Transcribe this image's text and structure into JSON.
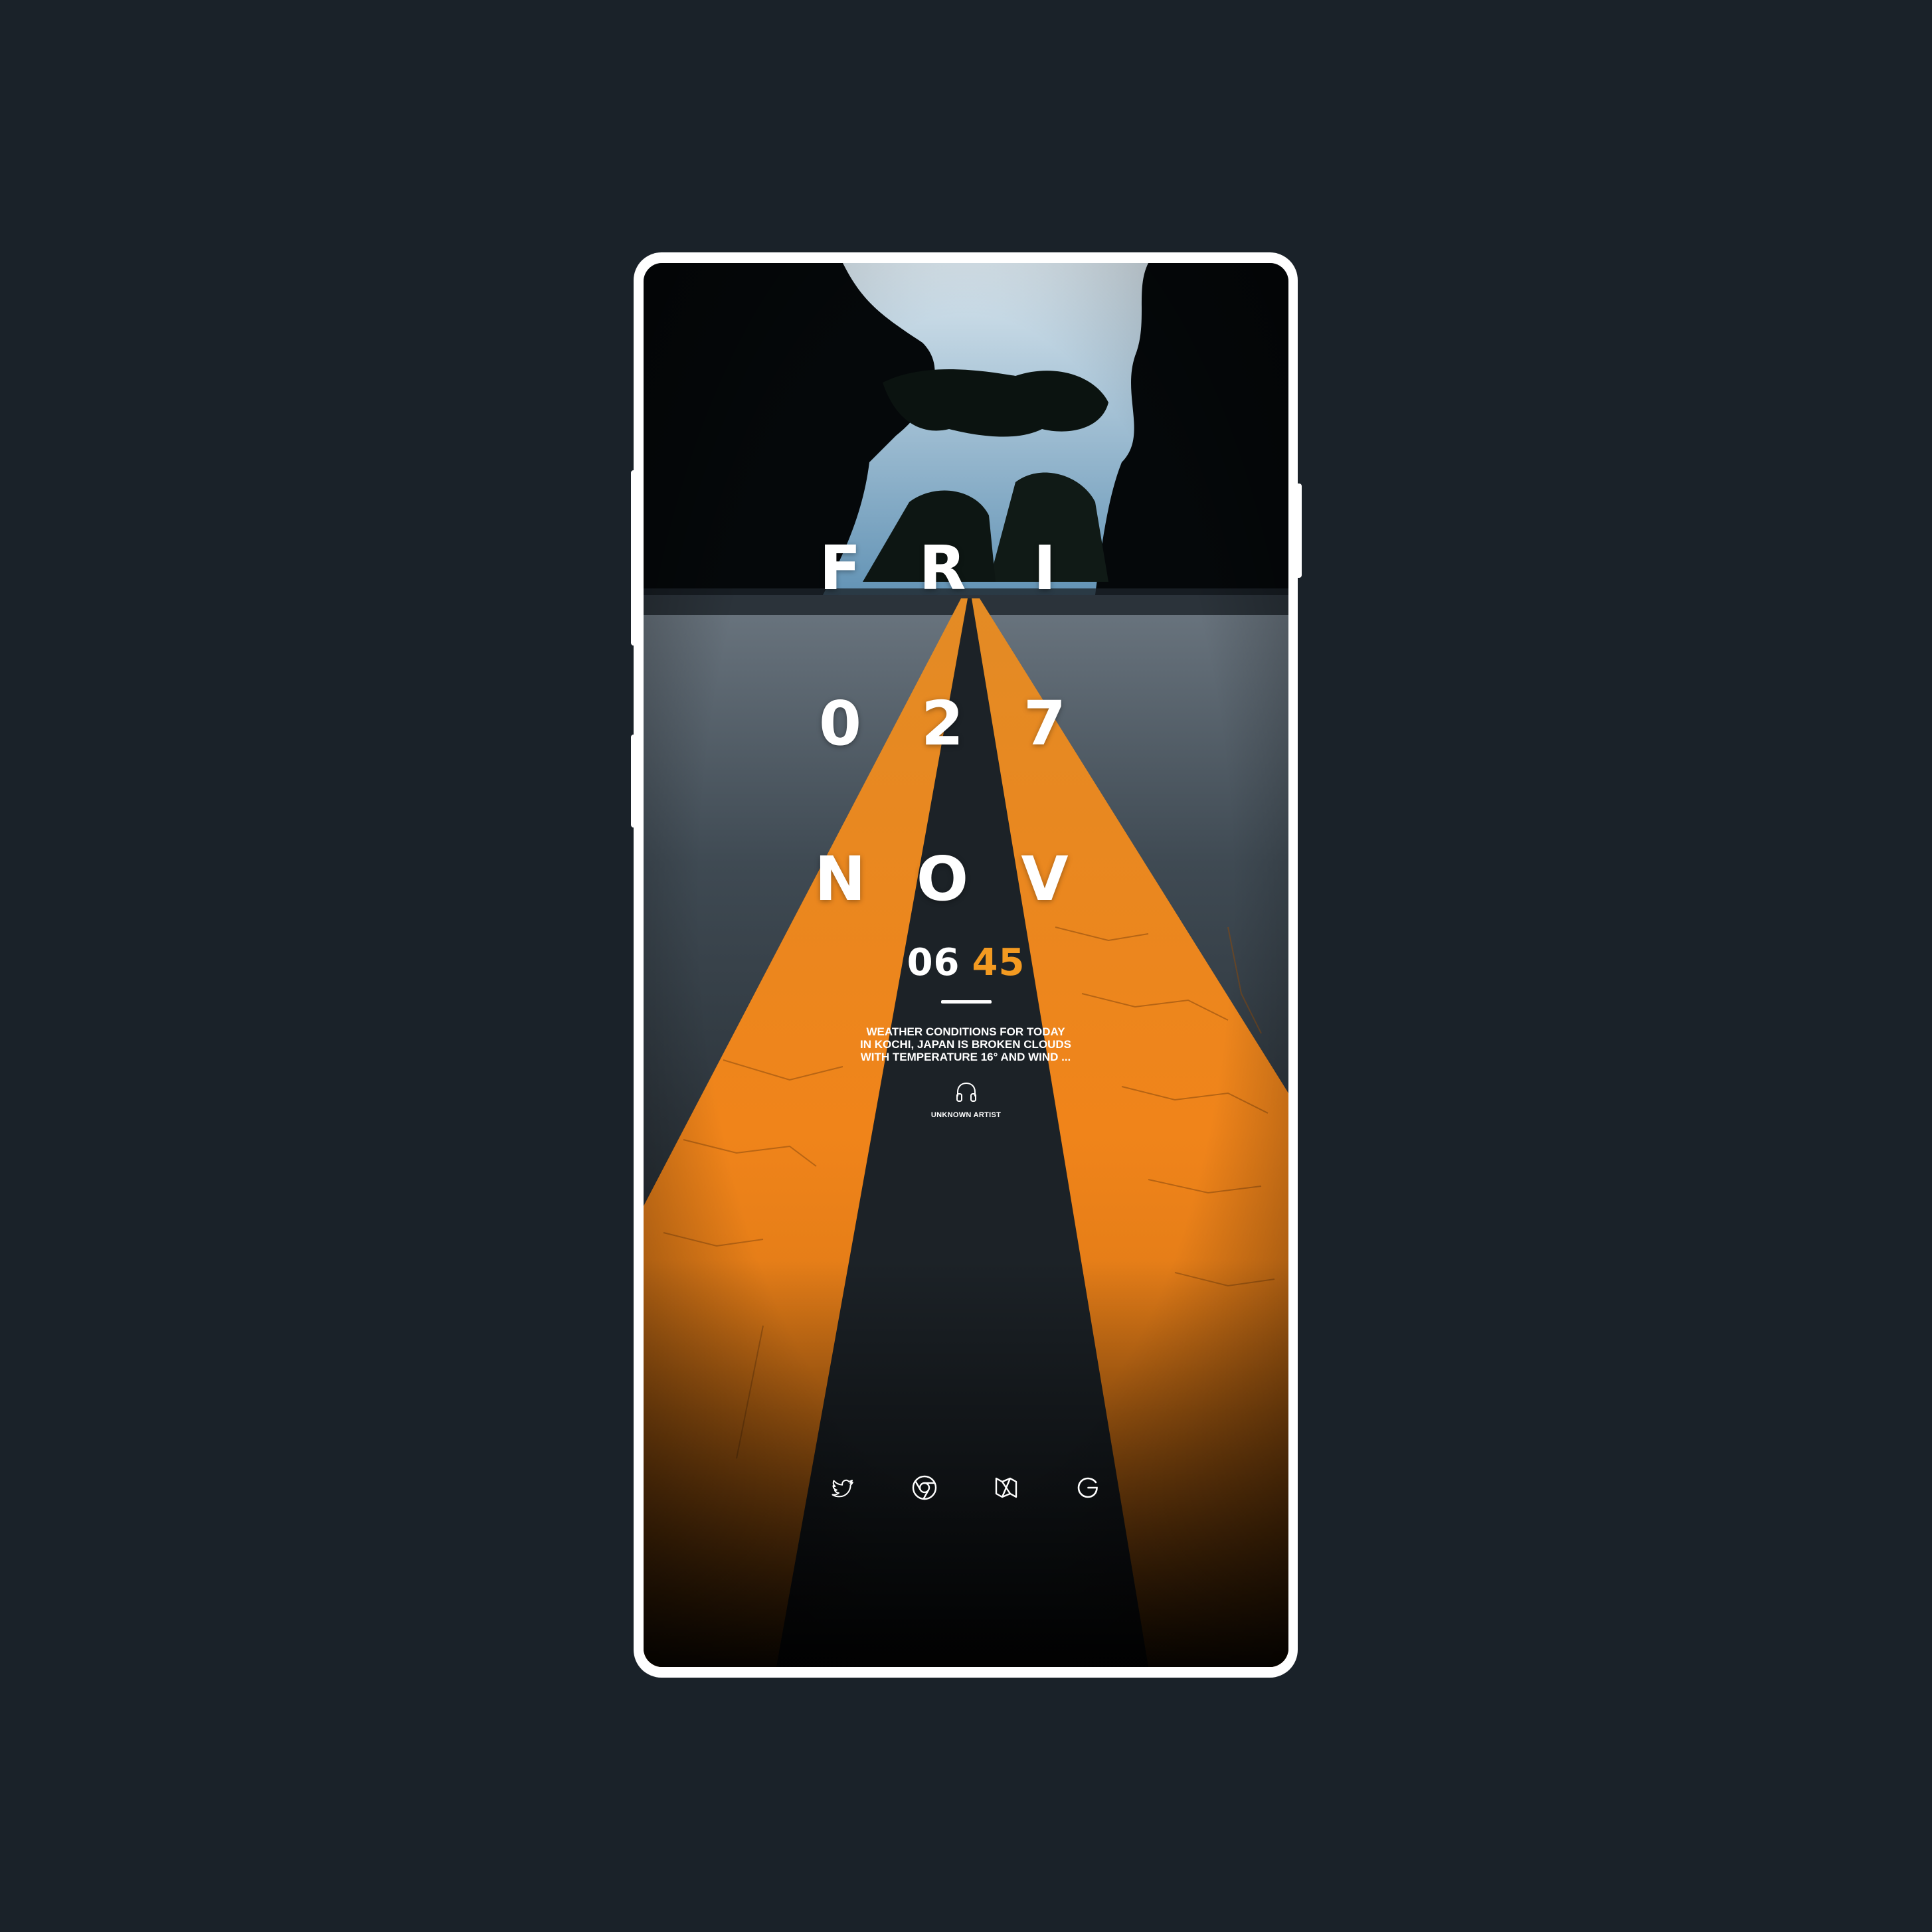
{
  "lockscreen": {
    "day_letters": [
      "F",
      "R",
      "I"
    ],
    "date_digits": [
      "0",
      "2",
      "7"
    ],
    "month_letters": [
      "N",
      "O",
      "V"
    ],
    "time": {
      "hour": "06",
      "minute": "45"
    },
    "weather_lines": [
      "WEATHER CONDITIONS FOR TODAY",
      "IN KOCHI, JAPAN IS BROKEN CLOUDS",
      "WITH TEMPERATURE 16° AND WIND ..."
    ],
    "music": {
      "icon": "headphones-icon",
      "artist": "UNKNOWN ARTIST"
    }
  },
  "dock": {
    "apps": [
      {
        "icon": "twitter-icon"
      },
      {
        "icon": "chrome-icon"
      },
      {
        "icon": "maps-icon"
      },
      {
        "icon": "google-icon"
      }
    ]
  },
  "colors": {
    "background": "#1a2229",
    "frame": "#ffffff",
    "accent_orange": "#f39a21",
    "text": "#ffffff"
  }
}
